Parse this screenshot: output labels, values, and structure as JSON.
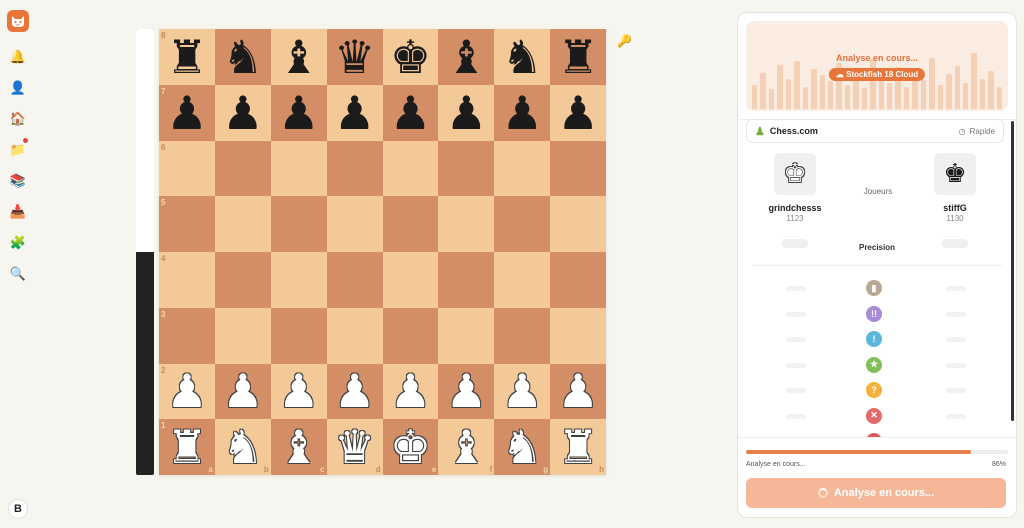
{
  "sidebar": {
    "items": [
      {
        "name": "notifications",
        "glyph": "🔔"
      },
      {
        "name": "profile",
        "glyph": "👤"
      },
      {
        "name": "home",
        "glyph": "🏠"
      },
      {
        "name": "folder",
        "glyph": "📁"
      },
      {
        "name": "library",
        "glyph": "📚"
      },
      {
        "name": "inbox",
        "glyph": "📥"
      },
      {
        "name": "puzzle",
        "glyph": "🧩"
      },
      {
        "name": "search",
        "glyph": "🔍"
      }
    ],
    "profile_initial": "B"
  },
  "eval": {
    "white_fraction": 0.5
  },
  "board": {
    "ranks": [
      "8",
      "7",
      "6",
      "5",
      "4",
      "3",
      "2",
      "1"
    ],
    "files": [
      "a",
      "b",
      "c",
      "d",
      "e",
      "f",
      "g",
      "h"
    ],
    "position": [
      [
        "bR",
        "bN",
        "bB",
        "bQ",
        "bK",
        "bB",
        "bN",
        "bR"
      ],
      [
        "bP",
        "bP",
        "bP",
        "bP",
        "bP",
        "bP",
        "bP",
        "bP"
      ],
      [
        "",
        "",
        "",
        "",
        "",
        "",
        "",
        ""
      ],
      [
        "",
        "",
        "",
        "",
        "",
        "",
        "",
        ""
      ],
      [
        "",
        "",
        "",
        "",
        "",
        "",
        "",
        ""
      ],
      [
        "",
        "",
        "",
        "",
        "",
        "",
        "",
        ""
      ],
      [
        "wP",
        "wP",
        "wP",
        "wP",
        "wP",
        "wP",
        "wP",
        "wP"
      ],
      [
        "wR",
        "wN",
        "wB",
        "wQ",
        "wK",
        "wB",
        "wN",
        "wR"
      ]
    ]
  },
  "panel": {
    "banner_title": "Analyse en cours...",
    "engine_label": "Stockfish 18 Cloud",
    "source": "Chess.com",
    "time_control": "Rapide",
    "players_label": "Joueurs",
    "precision_label": "Precision",
    "white_player": {
      "name": "grindchesss",
      "rating": "1123"
    },
    "black_player": {
      "name": "stiffG",
      "rating": "1130"
    },
    "classifications": [
      {
        "name": "book",
        "color": "#b9a68f",
        "glyph": "▮"
      },
      {
        "name": "brilliant",
        "color": "#a98ad8",
        "glyph": "!!"
      },
      {
        "name": "great",
        "color": "#5cb7d9",
        "glyph": "!"
      },
      {
        "name": "best",
        "color": "#82bf59",
        "glyph": "★"
      },
      {
        "name": "mistake",
        "color": "#f2b23b",
        "glyph": "?"
      },
      {
        "name": "miss",
        "color": "#e46b6b",
        "glyph": "✕"
      },
      {
        "name": "blunder",
        "color": "#dd5a5a",
        "glyph": "??"
      }
    ],
    "progress_label": "Analyse en cours...",
    "progress_pct": "86%",
    "progress_value": 0.86,
    "button_label": "Analyse en cours..."
  }
}
